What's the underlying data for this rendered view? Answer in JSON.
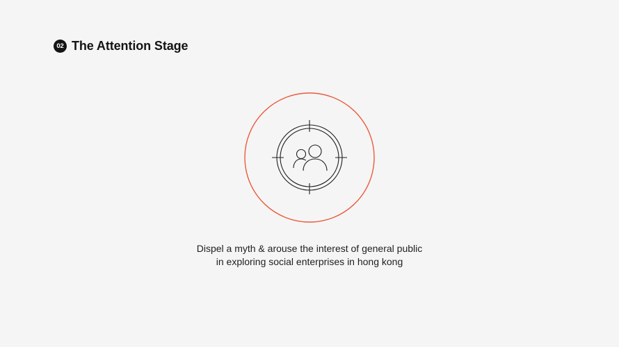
{
  "header": {
    "step_number": "02",
    "title": "The Attention Stage"
  },
  "icon": {
    "name": "audience-target-icon",
    "ring_color": "#ea5a3d",
    "line_color": "#1e1e1e"
  },
  "caption": {
    "line1": "Dispel a myth & arouse the interest of general public",
    "line2": "in exploring social enterprises in hong kong"
  }
}
